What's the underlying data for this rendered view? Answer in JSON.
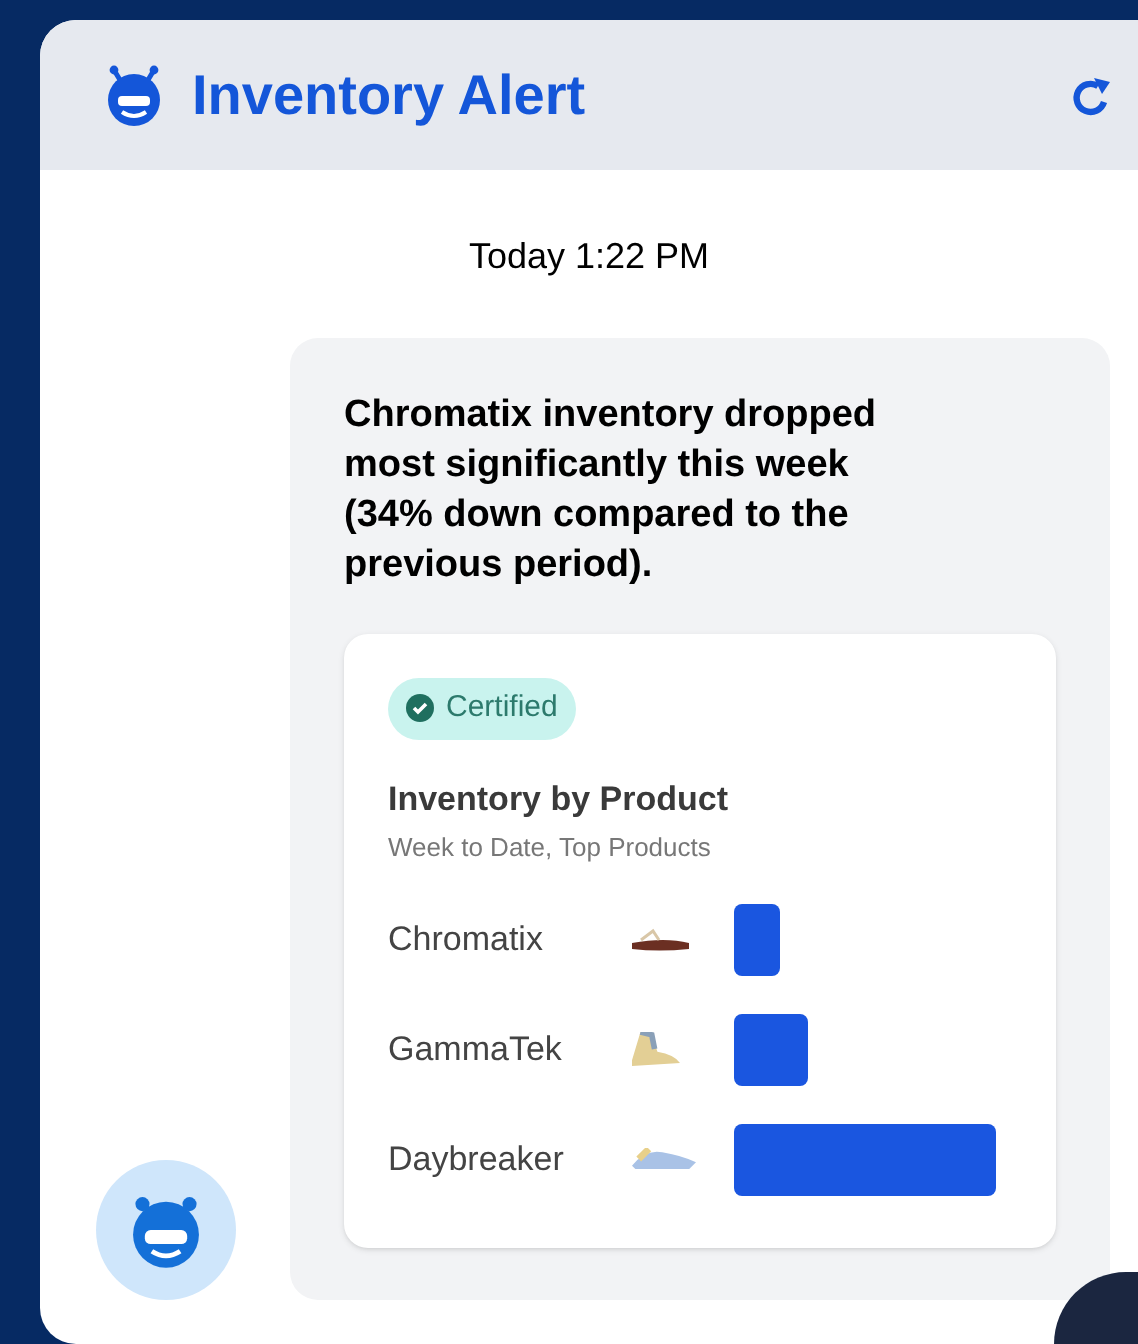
{
  "header": {
    "title": "Inventory Alert"
  },
  "timestamp": "Today 1:22 PM",
  "message": {
    "text": "Chromatix inventory dropped most significantly this week (34% down compared to the previous period).",
    "card": {
      "badge": "Certified",
      "title": "Inventory by Product",
      "subtitle": "Week to Date, Top Products",
      "products": [
        {
          "name": "Chromatix"
        },
        {
          "name": "GammaTek"
        },
        {
          "name": "Daybreaker"
        }
      ]
    }
  }
}
